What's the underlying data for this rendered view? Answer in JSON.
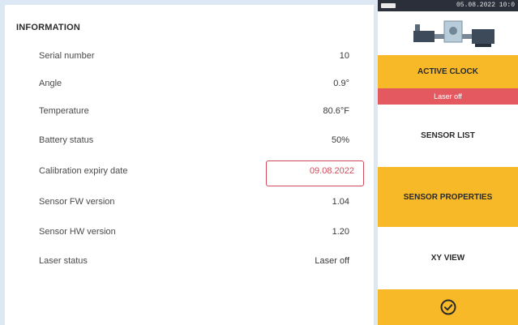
{
  "info": {
    "title": "INFORMATION",
    "rows": [
      {
        "label": "Serial number",
        "value": "10"
      },
      {
        "label": "Angle",
        "value": "0.9°"
      },
      {
        "label": "Temperature",
        "value": "80.6°F"
      },
      {
        "label": "Battery status",
        "value": "50%"
      },
      {
        "label": "Calibration expiry date",
        "value": "09.08.2022"
      },
      {
        "label": "Sensor FW version",
        "value": "1.04"
      },
      {
        "label": "Sensor HW version",
        "value": "1.20"
      },
      {
        "label": "Laser status",
        "value": "Laser off"
      }
    ]
  },
  "status_bar": {
    "text": "05.08.2022 10:0"
  },
  "sidebar": {
    "active_clock_label": "ACTIVE CLOCK",
    "laser_state": "Laser off",
    "sensor_list_label": "SENSOR LIST",
    "sensor_properties_label": "SENSOR PROPERTIES",
    "xy_view_label": "XY VIEW",
    "confirm_icon": "check-circle-icon"
  },
  "colors": {
    "accent_yellow": "#f7b928",
    "laser_red": "#e4585f",
    "highlight_border": "#d24b5a",
    "background": "#dde8f5"
  }
}
